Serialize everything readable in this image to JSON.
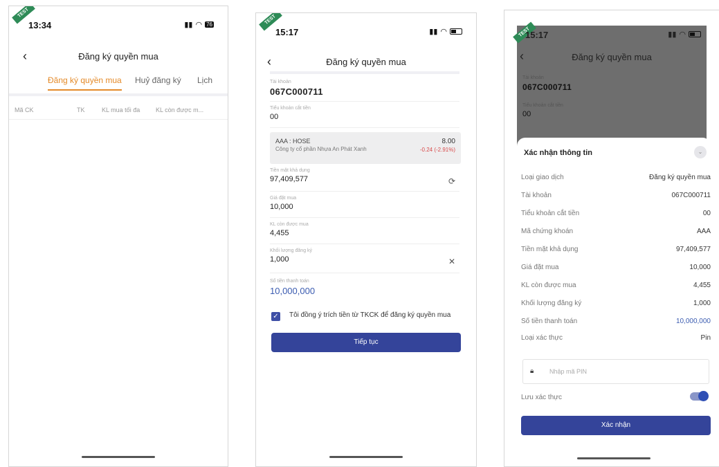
{
  "screen1": {
    "time": "13:34",
    "battery": "76",
    "title": "Đăng ký quyền mua",
    "tabs": [
      "Đăng ký quyền mua",
      "Huỷ đăng ký",
      "Lịch"
    ],
    "columns": [
      "Mã CK",
      "TK",
      "KL mua tối đa",
      "KL còn được m..."
    ]
  },
  "screen2": {
    "time": "15:17",
    "title": "Đăng ký quyền mua",
    "account_label": "Tài khoản",
    "account_value": "067C000711",
    "subaccount_label": "Tiểu khoản cắt tiền",
    "subaccount_value": "00",
    "stock": {
      "code": "AAA : HOSE",
      "name": "Công ty cổ phần Nhựa An Phát Xanh",
      "price": "8.00",
      "change": "-0.24 (-2.91%)"
    },
    "cash_label": "Tiền mặt khả dụng",
    "cash_value": "97,409,577",
    "price_label": "Giá đặt mua",
    "price_value": "10,000",
    "remaining_label": "KL còn được mua",
    "remaining_value": "4,455",
    "quantity_label": "Khối lượng đăng ký",
    "quantity_value": "1,000",
    "payment_label": "Số tiền thanh toán",
    "payment_value": "10,000,000",
    "agree_text": "Tôi đồng ý trích tiền từ TKCK để đăng ký quyền mua",
    "continue_label": "Tiếp tục"
  },
  "screen3": {
    "time": "15:17",
    "title": "Đăng ký quyền mua",
    "account_label": "Tài khoản",
    "account_value": "067C000711",
    "subaccount_label": "Tiểu khoản cắt tiền",
    "subaccount_value": "00",
    "sheet_title": "Xác nhận thông tin",
    "rows": [
      {
        "label": "Loại giao dịch",
        "value": "Đăng ký quyền mua"
      },
      {
        "label": "Tài khoản",
        "value": "067C000711"
      },
      {
        "label": "Tiểu khoản cắt tiền",
        "value": "00"
      },
      {
        "label": "Mã chứng khoán",
        "value": "AAA"
      },
      {
        "label": "Tiền mặt khả dụng",
        "value": "97,409,577"
      },
      {
        "label": "Giá đặt mua",
        "value": "10,000"
      },
      {
        "label": "KL còn được mua",
        "value": "4,455"
      },
      {
        "label": "Khối lượng đăng ký",
        "value": "1,000"
      },
      {
        "label": "Số tiền thanh toán",
        "value": "10,000,000"
      },
      {
        "label": "Loại xác thực",
        "value": "Pin"
      }
    ],
    "pin_placeholder": "Nhập mã PIN",
    "save_auth_label": "Lưu xác thực",
    "confirm_label": "Xác nhận"
  },
  "test_label": "TEST",
  "colors": {
    "accent": "#e48a29",
    "primary": "#34449a",
    "negative": "#d84a4a",
    "link": "#3a5bb0"
  }
}
